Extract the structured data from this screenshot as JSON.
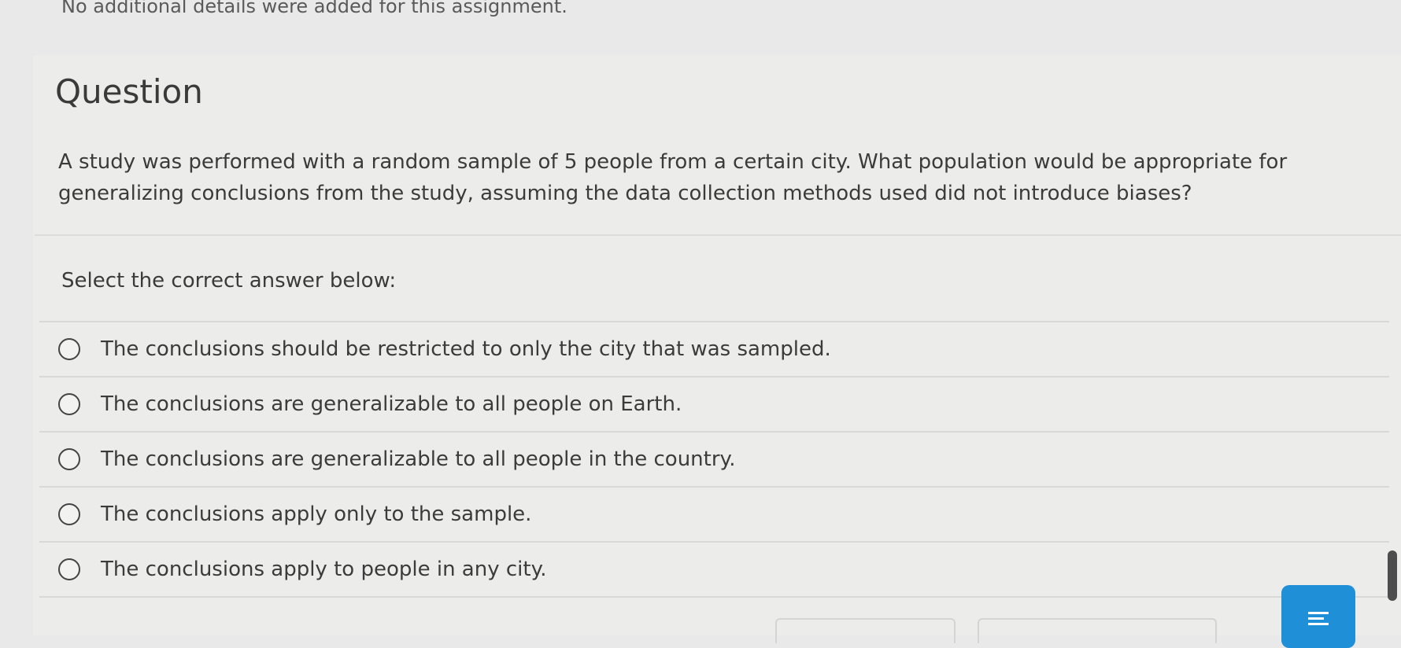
{
  "assignment": {
    "note": "No additional details were added for this assignment."
  },
  "question": {
    "heading": "Question",
    "text": "A study was performed with a random sample of 5 people from a certain city. What population would be appropriate for generalizing conclusions from the study, assuming the data collection methods used did not introduce biases?",
    "prompt": "Select the correct answer below:",
    "choices": [
      "The conclusions should be restricted to only the city that was sampled.",
      "The conclusions are generalizable to all people on Earth.",
      "The conclusions are generalizable to all people in the country.",
      "The conclusions apply only to the sample.",
      "The conclusions apply to people in any city."
    ]
  },
  "controls": {
    "menu_icon": "hamburger-menu-icon",
    "accent_color": "#1f8fd8"
  }
}
